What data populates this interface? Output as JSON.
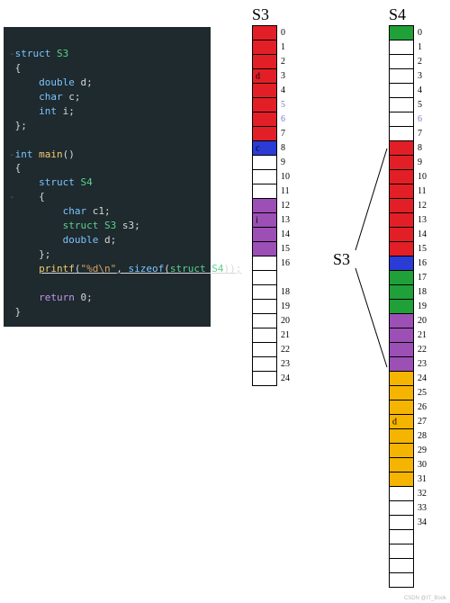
{
  "code": {
    "struct_kw": "struct",
    "s3_name": "S3",
    "double_kw": "double",
    "char_kw": "char",
    "int_kw": "int",
    "field_d": "d",
    "field_c": "c",
    "field_i": "i",
    "main_kw": "int",
    "main_name": "main",
    "s4_name": "S4",
    "field_c1": "c1",
    "field_s3": "s3",
    "field_s3_type": "struct S3",
    "field_d2": "d",
    "printf": "printf",
    "fmt": "\"%d\\n\"",
    "sizeof": "sizeof",
    "sizeof_arg": "struct S4",
    "return_kw": "return",
    "return_val": "0"
  },
  "titles": {
    "s3": "S3",
    "s4": "S4",
    "s3_callout": "S3"
  },
  "colors": {
    "red": "#e21f26",
    "blue": "#2a3bd6",
    "purple": "#9c4fb5",
    "green": "#1fa038",
    "gold": "#f5b400",
    "white": "#ffffff"
  },
  "chart_data": {
    "type": "table",
    "note": "Two memory-layout strips. Each entry = one byte. 'color' -> colors.* key. 'label' = inline badge text inside the byte cell. 'idx_label' = the index printed to the right; 'alt' means drawn in blue-ish instead of black.",
    "s3": {
      "title": "S3",
      "bytes": [
        {
          "i": 0,
          "color": "red",
          "idx_label": "0"
        },
        {
          "i": 1,
          "color": "red",
          "idx_label": "1"
        },
        {
          "i": 2,
          "color": "red",
          "idx_label": "2"
        },
        {
          "i": 3,
          "color": "red",
          "idx_label": "3",
          "label": "d"
        },
        {
          "i": 4,
          "color": "red",
          "idx_label": "4"
        },
        {
          "i": 5,
          "color": "red",
          "idx_label": "5",
          "alt": true
        },
        {
          "i": 6,
          "color": "red",
          "idx_label": "6",
          "alt": true
        },
        {
          "i": 7,
          "color": "red",
          "idx_label": "7"
        },
        {
          "i": 8,
          "color": "blue",
          "idx_label": "8",
          "label": "c"
        },
        {
          "i": 9,
          "color": "white",
          "idx_label": "9"
        },
        {
          "i": 10,
          "color": "white",
          "idx_label": "10"
        },
        {
          "i": 11,
          "color": "white",
          "idx_label": "11"
        },
        {
          "i": 12,
          "color": "purple",
          "idx_label": "12"
        },
        {
          "i": 13,
          "color": "purple",
          "idx_label": "13",
          "label": "i"
        },
        {
          "i": 14,
          "color": "purple",
          "idx_label": "14"
        },
        {
          "i": 15,
          "color": "purple",
          "idx_label": "15"
        },
        {
          "i": 16,
          "color": "white",
          "idx_label": "16"
        },
        {
          "i": 17,
          "color": "white"
        },
        {
          "i": 18,
          "color": "white",
          "idx_label": "18"
        },
        {
          "i": 19,
          "color": "white",
          "idx_label": "19"
        },
        {
          "i": 20,
          "color": "white",
          "idx_label": "20"
        },
        {
          "i": 21,
          "color": "white",
          "idx_label": "21"
        },
        {
          "i": 22,
          "color": "white",
          "idx_label": "22"
        },
        {
          "i": 23,
          "color": "white",
          "idx_label": "23"
        },
        {
          "i": 24,
          "color": "white",
          "idx_label": "24"
        }
      ],
      "summary": "S3 = { double d (0-7, red), char c (8, blue), pad (9-11), int i (12-15, purple) }; sizeof = 16; trailing rows past 16 are illustrative empty slots"
    },
    "s4": {
      "title": "S4",
      "bytes": [
        {
          "i": 0,
          "color": "green",
          "idx_label": "0"
        },
        {
          "i": 1,
          "color": "white",
          "idx_label": "1"
        },
        {
          "i": 2,
          "color": "white",
          "idx_label": "2"
        },
        {
          "i": 3,
          "color": "white",
          "idx_label": "3"
        },
        {
          "i": 4,
          "color": "white",
          "idx_label": "4"
        },
        {
          "i": 5,
          "color": "white",
          "idx_label": "5"
        },
        {
          "i": 6,
          "color": "white",
          "idx_label": "6",
          "alt": true
        },
        {
          "i": 7,
          "color": "white",
          "idx_label": "7"
        },
        {
          "i": 8,
          "color": "red",
          "idx_label": "8"
        },
        {
          "i": 9,
          "color": "red",
          "idx_label": "9"
        },
        {
          "i": 10,
          "color": "red",
          "idx_label": "10"
        },
        {
          "i": 11,
          "color": "red",
          "idx_label": "11"
        },
        {
          "i": 12,
          "color": "red",
          "idx_label": "12"
        },
        {
          "i": 13,
          "color": "red",
          "idx_label": "13"
        },
        {
          "i": 14,
          "color": "red",
          "idx_label": "14"
        },
        {
          "i": 15,
          "color": "red",
          "idx_label": "15"
        },
        {
          "i": 16,
          "color": "blue",
          "idx_label": "16"
        },
        {
          "i": 17,
          "color": "green",
          "idx_label": "17"
        },
        {
          "i": 18,
          "color": "green",
          "idx_label": "18"
        },
        {
          "i": 19,
          "color": "green",
          "idx_label": "19"
        },
        {
          "i": 20,
          "color": "purple",
          "idx_label": "20"
        },
        {
          "i": 21,
          "color": "purple",
          "idx_label": "21"
        },
        {
          "i": 22,
          "color": "purple",
          "idx_label": "22"
        },
        {
          "i": 23,
          "color": "purple",
          "idx_label": "23"
        },
        {
          "i": 24,
          "color": "gold",
          "idx_label": "24"
        },
        {
          "i": 25,
          "color": "gold",
          "idx_label": "25"
        },
        {
          "i": 26,
          "color": "gold",
          "idx_label": "26"
        },
        {
          "i": 27,
          "color": "gold",
          "idx_label": "27",
          "label": "d"
        },
        {
          "i": 28,
          "color": "gold",
          "idx_label": "28"
        },
        {
          "i": 29,
          "color": "gold",
          "idx_label": "29"
        },
        {
          "i": 30,
          "color": "gold",
          "idx_label": "30"
        },
        {
          "i": 31,
          "color": "gold",
          "idx_label": "31"
        },
        {
          "i": 32,
          "color": "white",
          "idx_label": "32"
        },
        {
          "i": 33,
          "color": "white",
          "idx_label": "33"
        },
        {
          "i": 34,
          "color": "white",
          "idx_label": "34"
        },
        {
          "i": 35,
          "color": "white"
        },
        {
          "i": 36,
          "color": "white"
        },
        {
          "i": 37,
          "color": "white"
        },
        {
          "i": 38,
          "color": "white"
        }
      ],
      "s3_span": {
        "from": 8,
        "to": 23
      },
      "summary": "S4 = { char c1 (0, green), pad (1-7), struct S3 s3 (8-23), double d (24-31, gold) }; sizeof = 32"
    }
  },
  "watermark": "CSDN @IT_Book"
}
